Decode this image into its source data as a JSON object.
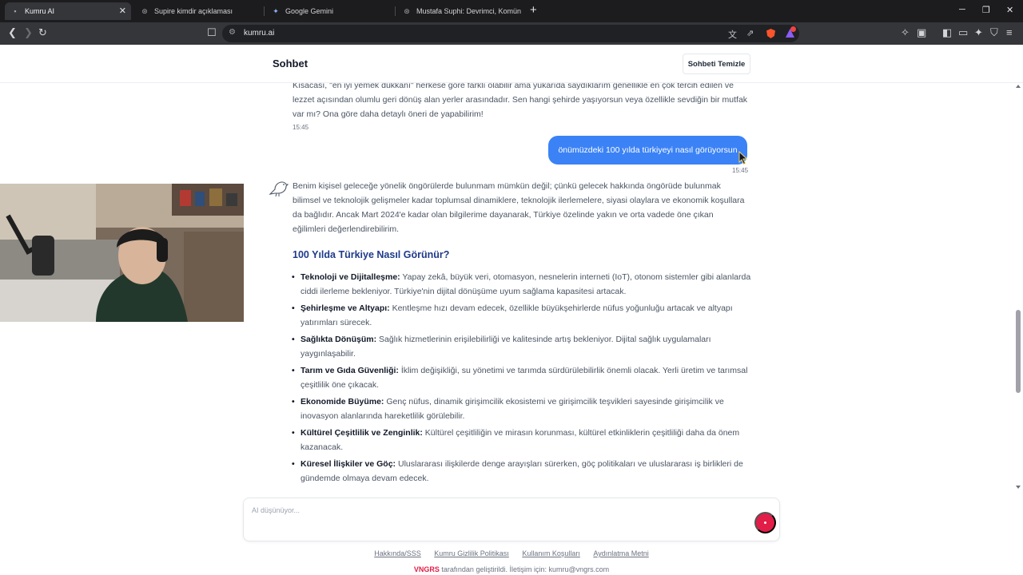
{
  "browser": {
    "tabs": [
      {
        "title": "Kumru AI",
        "icon": "kumru-favicon",
        "active": true
      },
      {
        "title": "Supire kimdir açıklaması",
        "icon": "openai-icon",
        "active": false
      },
      {
        "title": "Google Gemini",
        "icon": "gemini-icon",
        "active": false
      },
      {
        "title": "Mustafa Suphi: Devrimci, Komünist l",
        "icon": "openai-icon",
        "active": false
      }
    ],
    "address": "kumru.ai"
  },
  "header": {
    "title": "Sohbet",
    "clear_label": "Sohbeti Temizle"
  },
  "chat": {
    "prev_ai_text": "Kısacası, \"en iyi yemek dükkanı\" herkese göre farklı olabilir ama yukarıda saydıklarım genellikle en çok tercih edilen ve lezzet açısından olumlu geri dönüş alan yerler arasındadır. Sen hangi şehirde yaşıyorsun veya özellikle sevdiğin bir mutfak var mı? Ona göre daha detaylı öneri de yapabilirim!",
    "prev_ai_time": "15:45",
    "user_message": "önümüzdeki 100 yılda türkiyeyi nasıl görüyorsun",
    "user_time": "15:45",
    "ai_intro": "Benim kişisel geleceğe yönelik öngörülerde bulunmam mümkün değil; çünkü gelecek hakkında öngörüde bulunmak bilimsel ve teknolojik gelişmeler kadar toplumsal dinamiklere, teknolojik ilerlemelere, siyasi olaylara ve ekonomik koşullara da bağlıdır. Ancak Mart 2024'e kadar olan bilgilerime dayanarak, Türkiye özelinde yakın ve orta vadede öne çıkan eğilimleri değerlendirebilirim.",
    "ai_heading": "100 Yılda Türkiye Nasıl Görünür?",
    "bullets": [
      {
        "title": "Teknoloji ve Dijitalleşme:",
        "text": " Yapay zekâ, büyük veri, otomasyon, nesnelerin interneti (IoT), otonom sistemler gibi alanlarda ciddi ilerleme bekleniyor. Türkiye'nin dijital dönüşüme uyum sağlama kapasitesi artacak."
      },
      {
        "title": "Şehirleşme ve Altyapı:",
        "text": " Kentleşme hızı devam edecek, özellikle büyükşehirlerde nüfus yoğunluğu artacak ve altyapı yatırımları sürecek."
      },
      {
        "title": "Sağlıkta Dönüşüm:",
        "text": " Sağlık hizmetlerinin erişilebilirliği ve kalitesinde artış bekleniyor. Dijital sağlık uygulamaları yaygınlaşabilir."
      },
      {
        "title": "Tarım ve Gıda Güvenliği:",
        "text": " İklim değişikliği, su yönetimi ve tarımda sürdürülebilirlik önemli olacak. Yerli üretim ve tarımsal çeşitlilik öne çıkacak."
      },
      {
        "title": "Ekonomide Büyüme:",
        "text": " Genç nüfus, dinamik girişimcilik ekosistemi ve girişimcilik teşvikleri sayesinde girişimcilik ve inovasyon alanlarında hareketlilik görülebilir."
      },
      {
        "title": "Kültürel Çeşitlilik ve Zenginlik:",
        "text": " Kültürel çeşitliliğin ve mirasın korunması, kültürel etkinliklerin çeşitliliği daha da önem kazanacak."
      },
      {
        "title": "Küresel İlişkiler ve Göç:",
        "text": " Uluslararası ilişkilerde denge arayışları sürerken, göç politikaları ve uluslararası iş birlikleri de gündemde olmaya devam edecek."
      }
    ]
  },
  "input": {
    "placeholder": "AI düşünüyor..."
  },
  "footer": {
    "links": [
      "Hakkında/SSS",
      "Kumru Gizlilik Politikası",
      "Kullanım Koşulları",
      "Aydınlatma Metni"
    ],
    "brand": "VNGRS",
    "note": " tarafından geliştirildi. İletişim için: kumru@vngrs.com"
  },
  "colors": {
    "user_bubble": "#3b82f6",
    "heading": "#1e3a8a",
    "send_button": "#e11d48",
    "brand": "#e11d48"
  }
}
